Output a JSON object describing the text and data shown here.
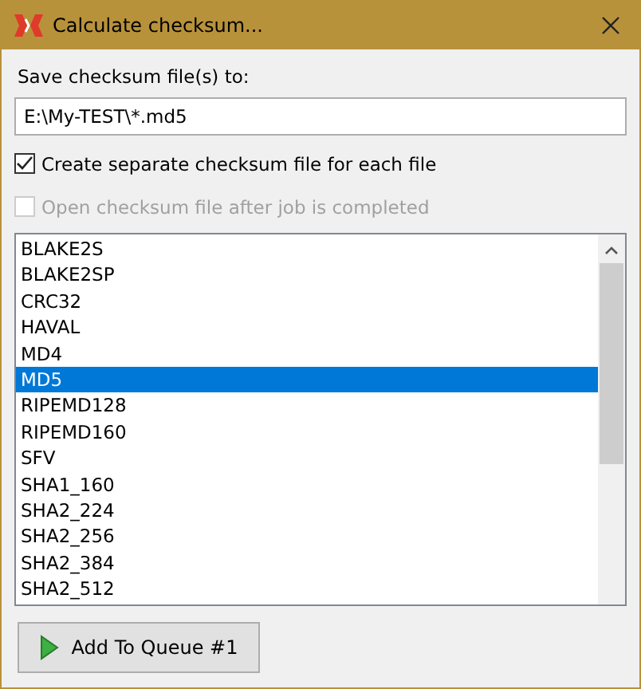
{
  "window": {
    "title": "Calculate checksum..."
  },
  "save_to": {
    "label": "Save checksum file(s) to:",
    "value": "E:\\My-TEST\\*.md5"
  },
  "options": [
    {
      "label": "Create separate checksum file for each file",
      "checked": true,
      "disabled": false
    },
    {
      "label": "Open checksum file after job is completed",
      "checked": false,
      "disabled": true
    }
  ],
  "algorithms": [
    {
      "label": "BLAKE2S",
      "selected": false
    },
    {
      "label": "BLAKE2SP",
      "selected": false
    },
    {
      "label": "CRC32",
      "selected": false
    },
    {
      "label": "HAVAL",
      "selected": false
    },
    {
      "label": "MD4",
      "selected": false
    },
    {
      "label": "MD5",
      "selected": true
    },
    {
      "label": "RIPEMD128",
      "selected": false
    },
    {
      "label": "RIPEMD160",
      "selected": false
    },
    {
      "label": "SFV",
      "selected": false
    },
    {
      "label": "SHA1_160",
      "selected": false
    },
    {
      "label": "SHA2_224",
      "selected": false
    },
    {
      "label": "SHA2_256",
      "selected": false
    },
    {
      "label": "SHA2_384",
      "selected": false
    },
    {
      "label": "SHA2_512",
      "selected": false
    }
  ],
  "buttons": [
    {
      "label": "Add To Queue #1"
    }
  ]
}
